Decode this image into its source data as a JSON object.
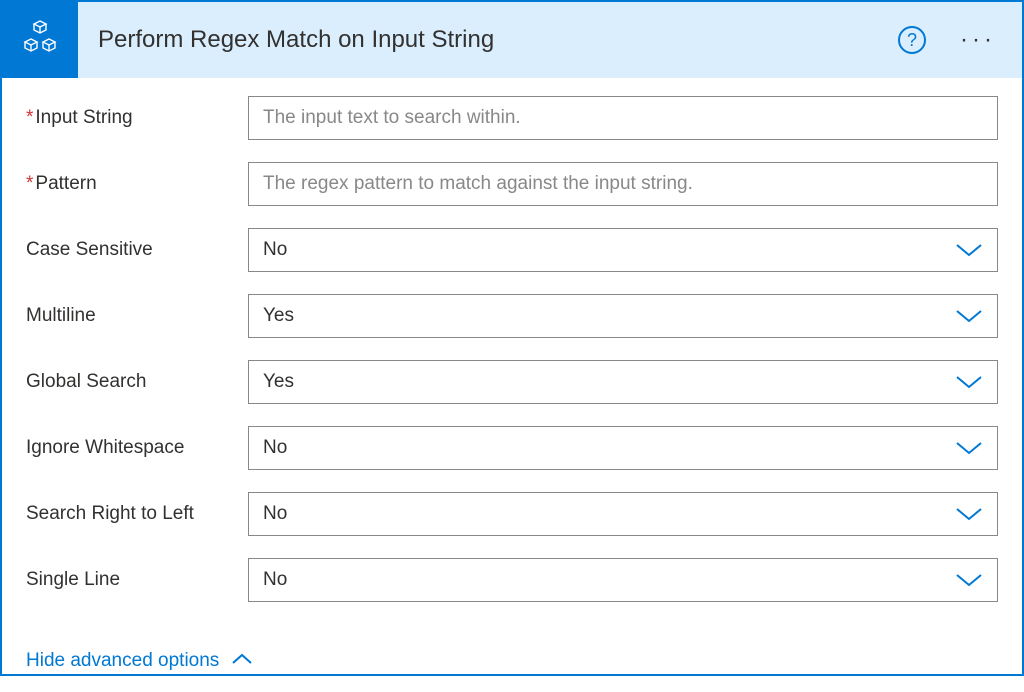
{
  "colors": {
    "accent": "#0078d4",
    "headerBg": "#dbeefe",
    "border": "#0078d4",
    "required": "#d13438"
  },
  "header": {
    "title": "Perform Regex Match on Input String",
    "icon": "cubes-icon"
  },
  "fields": {
    "inputString": {
      "label": "Input String",
      "placeholder": "The input text to search within.",
      "required": true,
      "value": ""
    },
    "pattern": {
      "label": "Pattern",
      "placeholder": "The regex pattern to match against the input string.",
      "required": true,
      "value": ""
    },
    "caseSensitive": {
      "label": "Case Sensitive",
      "value": "No"
    },
    "multiline": {
      "label": "Multiline",
      "value": "Yes"
    },
    "globalSearch": {
      "label": "Global Search",
      "value": "Yes"
    },
    "ignoreWhitespace": {
      "label": "Ignore Whitespace",
      "value": "No"
    },
    "rightToLeft": {
      "label": "Search Right to Left",
      "value": "No"
    },
    "singleLine": {
      "label": "Single Line",
      "value": "No"
    }
  },
  "advancedToggle": {
    "label": "Hide advanced options"
  }
}
